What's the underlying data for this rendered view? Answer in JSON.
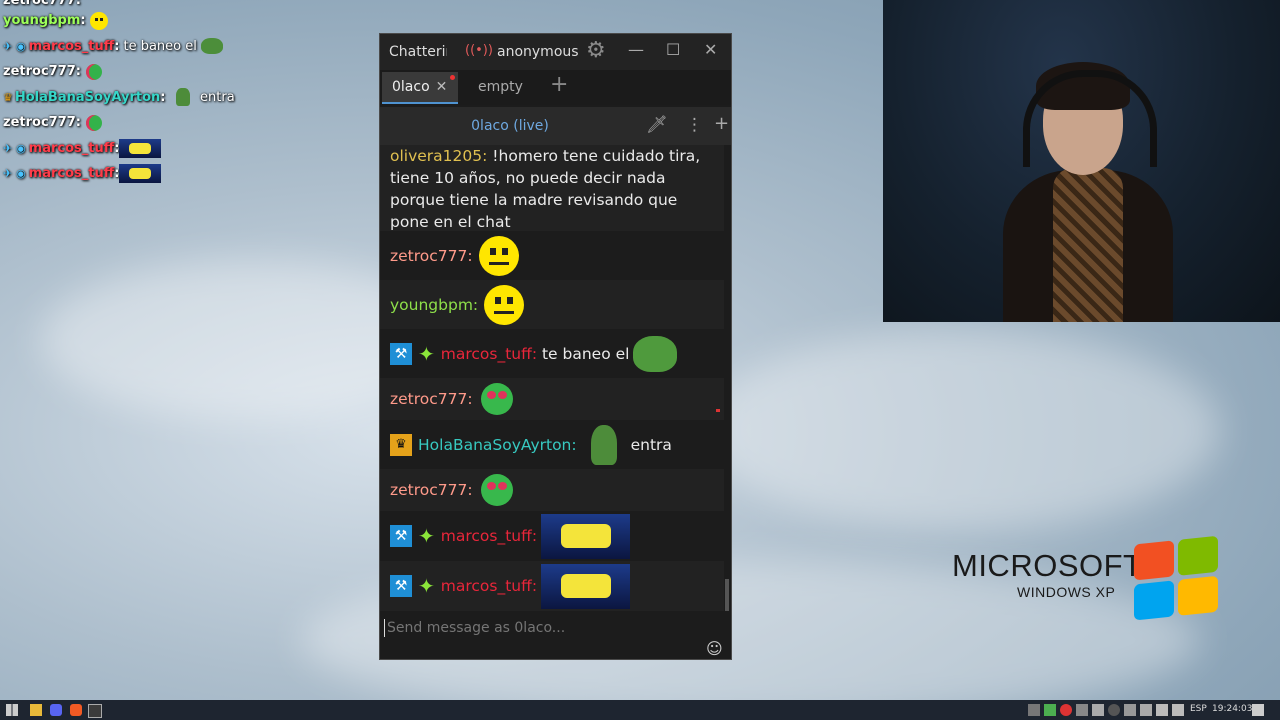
{
  "overlay_chat": {
    "lines": [
      {
        "user": "youngbpm",
        "user_color": "#9dff5a",
        "message": ""
      },
      {
        "user": "marcos_tuff",
        "user_color": "#ff3c4a",
        "message": "te baneo el"
      },
      {
        "user": "zetroc777",
        "user_color": "#ffffff",
        "message": ""
      },
      {
        "user": "HolaBanaSoyAyrton",
        "user_color": "#37d6c9",
        "message": "entra"
      },
      {
        "user": "zetroc777",
        "user_color": "#ffffff",
        "message": ""
      },
      {
        "user": "marcos_tuff",
        "user_color": "#ff3c4a",
        "message": ""
      },
      {
        "user": "marcos_tuff",
        "user_color": "#ff3c4a",
        "message": ""
      }
    ]
  },
  "window": {
    "title": "Chatterino",
    "account": "anonymous",
    "tabs": [
      {
        "label": "0laco",
        "active": true
      },
      {
        "label": "empty",
        "active": false
      }
    ],
    "split_title": "0laco (live)",
    "input_placeholder": "Send message as 0laco..."
  },
  "messages": [
    {
      "user": "olivera1205",
      "user_color": "#e0c050",
      "text": "!homero tene cuidado tira, tiene 10 años, no puede decir nada porque tiene la madre revisando que pone en el chat",
      "emote": ""
    },
    {
      "user": "zetroc777",
      "user_color": "#ff9a8a",
      "text": "",
      "emote": "smile-emote"
    },
    {
      "user": "youngbpm",
      "user_color": "#8ee04a",
      "text": "",
      "emote": "smile-emote"
    },
    {
      "user": "marcos_tuff",
      "user_color": "#e8263a",
      "text": "te baneo el",
      "emote": "pepe-emote",
      "badges": [
        "moderator",
        "sparkle"
      ]
    },
    {
      "user": "zetroc777",
      "user_color": "#ff9a8a",
      "text": "",
      "emote": "heart-emote"
    },
    {
      "user": "HolaBanaSoyAyrton",
      "user_color": "#37c9c0",
      "text": "entra",
      "emote": "pepe-standing-emote",
      "badges": [
        "crown"
      ]
    },
    {
      "user": "zetroc777",
      "user_color": "#ff9a8a",
      "text": "",
      "emote": "heart-emote"
    },
    {
      "user": "marcos_tuff",
      "user_color": "#e8263a",
      "text": "",
      "emote": "image-emote",
      "badges": [
        "moderator",
        "sparkle"
      ]
    },
    {
      "user": "marcos_tuff",
      "user_color": "#e8263a",
      "text": "",
      "emote": "image-emote",
      "badges": [
        "moderator",
        "sparkle"
      ]
    }
  ],
  "xp_logo": {
    "brand": "MICROSOFT",
    "product": "WINDOWS XP"
  },
  "taskbar": {
    "language": "ESP",
    "time": "19:24:03"
  }
}
